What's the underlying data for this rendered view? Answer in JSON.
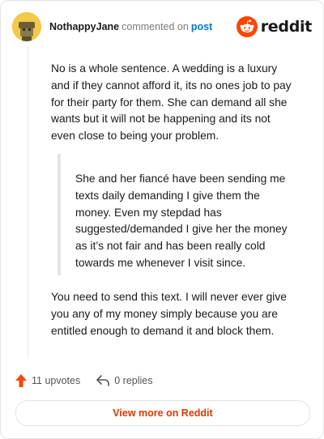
{
  "header": {
    "username": "NothappyJane",
    "action": "commented on",
    "post_link": "post",
    "brand": "reddit"
  },
  "comment": {
    "paragraph_1": "No is a whole sentence. A wedding is a luxury and if they cannot afford it, its no ones job to pay for their party for them. She can demand all she wants but it will not be happening and its not even close to being your problem.",
    "quote": "She and her fiancé have been sending me texts daily demanding I give them the money. Even my stepdad has suggested/demanded I give her the money as it’s not fair and has been really cold towards me whenever I visit since.",
    "paragraph_2": "You need to send this text. I will never ever give you any of my money simply because you are entitled enough to demand it and block them."
  },
  "footer": {
    "upvotes": "11 upvotes",
    "replies": "0 replies",
    "view_button": "View more on Reddit"
  },
  "colors": {
    "accent": "#ff4500",
    "link": "#0079d3",
    "button_text": "#d93a00"
  }
}
